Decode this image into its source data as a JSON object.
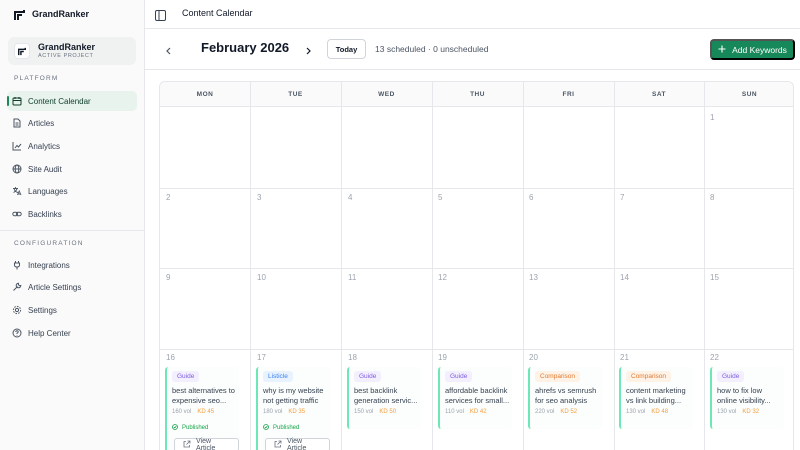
{
  "sidebar": {
    "brand": "GrandRanker",
    "project": {
      "name": "GrandRanker",
      "subtitle": "ACTIVE PROJECT"
    },
    "platform_label": "PLATFORM",
    "platform_items": [
      {
        "label": "Content Calendar",
        "icon": "calendar-icon",
        "active": true
      },
      {
        "label": "Articles",
        "icon": "document-icon"
      },
      {
        "label": "Analytics",
        "icon": "chart-icon"
      },
      {
        "label": "Site Audit",
        "icon": "globe-icon"
      },
      {
        "label": "Languages",
        "icon": "translate-icon"
      },
      {
        "label": "Backlinks",
        "icon": "link-icon"
      }
    ],
    "config_label": "CONFIGURATION",
    "config_items": [
      {
        "label": "Integrations",
        "icon": "plug-icon"
      },
      {
        "label": "Article Settings",
        "icon": "tools-icon"
      },
      {
        "label": "Settings",
        "icon": "gear-icon"
      },
      {
        "label": "Help Center",
        "icon": "help-icon"
      }
    ]
  },
  "topbar": {
    "breadcrumb": "Content Calendar"
  },
  "header": {
    "month": "February 2026",
    "today_label": "Today",
    "schedule_summary": "13 scheduled · 0 unscheduled",
    "add_keywords_label": "Add Keywords"
  },
  "calendar": {
    "weekdays": [
      "MON",
      "TUE",
      "WED",
      "THU",
      "FRI",
      "SAT",
      "SUN"
    ],
    "weeks": [
      [
        "",
        "",
        "",
        "",
        "",
        "",
        "1"
      ],
      [
        "2",
        "3",
        "4",
        "5",
        "6",
        "7",
        "8"
      ],
      [
        "9",
        "10",
        "11",
        "12",
        "13",
        "14",
        "15"
      ],
      [
        "16",
        "17",
        "18",
        "19",
        "20",
        "21",
        "22"
      ]
    ],
    "articles": [
      {
        "day": "16",
        "tag": "Guide",
        "title": "best alternatives to expensive seo...",
        "vol": "160 vol",
        "kd": "KD 45",
        "status": "Published",
        "action": "View Article"
      },
      {
        "day": "17",
        "tag": "Listicle",
        "title": "why is my website not getting traffic",
        "vol": "180 vol",
        "kd": "KD 35",
        "status": "Published",
        "action": "View Article"
      },
      {
        "day": "18",
        "tag": "Guide",
        "title": "best backlink generation servic...",
        "vol": "150 vol",
        "kd": "KD 50"
      },
      {
        "day": "19",
        "tag": "Guide",
        "title": "affordable backlink services for small...",
        "vol": "110 vol",
        "kd": "KD 42"
      },
      {
        "day": "20",
        "tag": "Comparison",
        "title": "ahrefs vs semrush for seo analysis",
        "vol": "220 vol",
        "kd": "KD 52"
      },
      {
        "day": "21",
        "tag": "Comparison",
        "title": "content marketing vs link building...",
        "vol": "130 vol",
        "kd": "KD 48"
      },
      {
        "day": "22",
        "tag": "Guide",
        "title": "how to fix low online visibility...",
        "vol": "130 vol",
        "kd": "KD 32"
      }
    ]
  },
  "colors": {
    "accent": "#17885a",
    "active_nav_bg": "#e7f3ec",
    "guide": "#7c5ce0",
    "listicle": "#3b82f6",
    "comparison": "#e07a2f"
  }
}
